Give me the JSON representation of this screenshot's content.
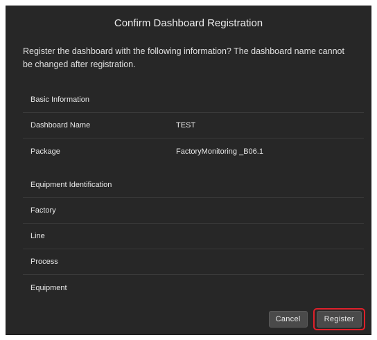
{
  "dialog": {
    "title": "Confirm Dashboard Registration",
    "message": "Register the dashboard with the following information? The dashboard name cannot be changed after registration."
  },
  "basic_info": {
    "heading": "Basic Information",
    "rows": [
      {
        "label": "Dashboard Name",
        "value": "TEST"
      },
      {
        "label": "Package",
        "value": "FactoryMonitoring _B06.1"
      }
    ]
  },
  "equipment_id": {
    "heading": "Equipment Identification",
    "rows": [
      {
        "label": "Factory",
        "value": ""
      },
      {
        "label": "Line",
        "value": ""
      },
      {
        "label": "Process",
        "value": ""
      },
      {
        "label": "Equipment",
        "value": ""
      }
    ]
  },
  "buttons": {
    "cancel": "Cancel",
    "register": "Register"
  },
  "colors": {
    "dialog_bg": "#272727",
    "highlight": "#e0202a"
  }
}
